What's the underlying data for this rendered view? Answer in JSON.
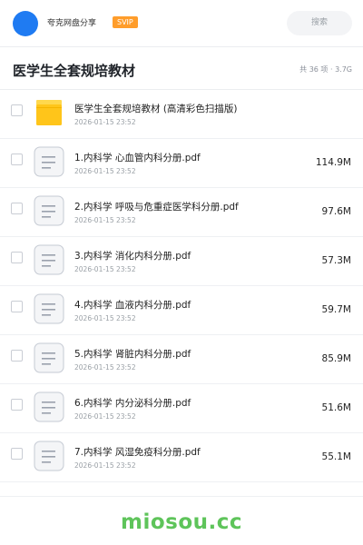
{
  "header": {
    "app_name": "夸克网盘分享",
    "badge": "SVIP",
    "search_placeholder": "搜索"
  },
  "folder": {
    "title": "医学生全套规培教材",
    "summary": "共 36 项 · 3.7G"
  },
  "items": [
    {
      "type": "folder",
      "name": "医学生全套规培教材 (高清彩色扫描版)",
      "date": "2026-01-15 23:52",
      "size": ""
    },
    {
      "type": "pdf",
      "name": "1.内科学 心血管内科分册.pdf",
      "date": "2026-01-15 23:52",
      "size": "114.9M"
    },
    {
      "type": "pdf",
      "name": "2.内科学 呼吸与危重症医学科分册.pdf",
      "date": "2026-01-15 23:52",
      "size": "97.6M"
    },
    {
      "type": "pdf",
      "name": "3.内科学 消化内科分册.pdf",
      "date": "2026-01-15 23:52",
      "size": "57.3M"
    },
    {
      "type": "pdf",
      "name": "4.内科学 血液内科分册.pdf",
      "date": "2026-01-15 23:52",
      "size": "59.7M"
    },
    {
      "type": "pdf",
      "name": "5.内科学 肾脏内科分册.pdf",
      "date": "2026-01-15 23:52",
      "size": "85.9M"
    },
    {
      "type": "pdf",
      "name": "6.内科学 内分泌科分册.pdf",
      "date": "2026-01-15 23:52",
      "size": "51.6M"
    },
    {
      "type": "pdf",
      "name": "7.内科学 风湿免疫科分册.pdf",
      "date": "2026-01-15 23:52",
      "size": "55.1M"
    }
  ],
  "watermark": "miosou.cc",
  "colors": {
    "avatar": "#1f7bf2",
    "badge": "#ff9d2b",
    "folder_icon": "#ffc51a",
    "watermark": "#5ec45a"
  }
}
